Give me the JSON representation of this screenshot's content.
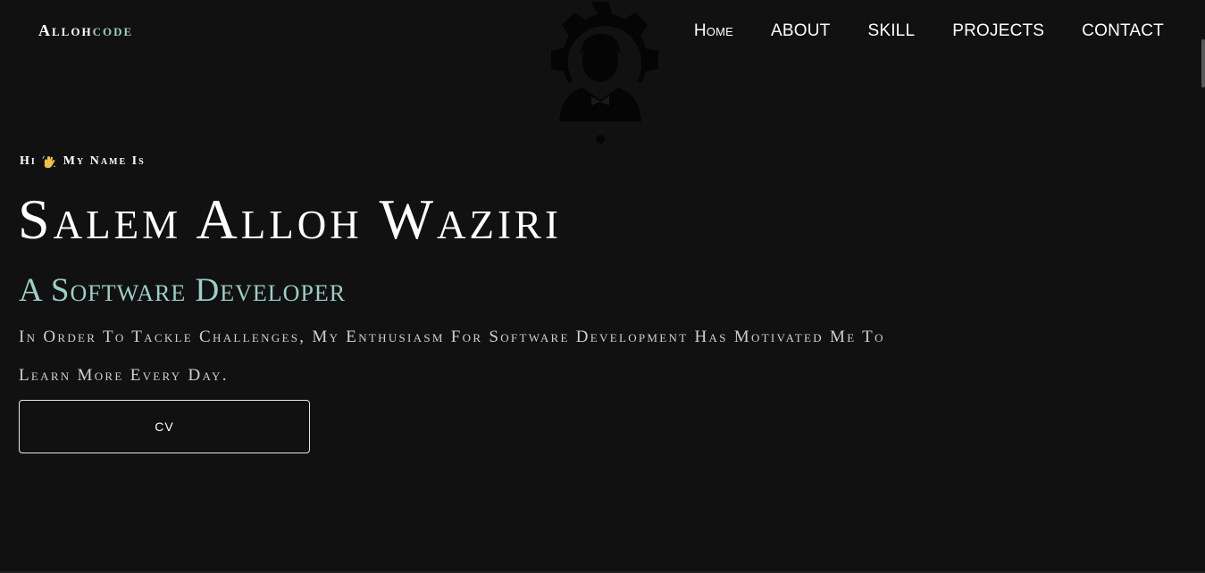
{
  "header": {
    "brand_main": "Alloh",
    "brand_accent": "code",
    "nav": [
      {
        "label": "Home"
      },
      {
        "label": "ABOUT"
      },
      {
        "label": "SKILL"
      },
      {
        "label": "PROJECTS"
      },
      {
        "label": "CONTACT"
      }
    ]
  },
  "logo": {
    "icon": "developer-gear-avatar-icon"
  },
  "hero": {
    "greeting_start": "Hi",
    "greeting_emoji": "waving-hand-icon",
    "greeting_end": "My Name Is",
    "name": "Salem Alloh Waziri",
    "role": "A Software Developer",
    "bio": "In Order To Tackle Challenges, My Enthusiasm For Software Development Has Motivated Me To Learn More Every Day.",
    "cv_label": "CV"
  },
  "colors": {
    "background": "#111111",
    "accent": "#9ccfc6",
    "text": "#ffffff",
    "muted": "#d0d0d0"
  }
}
